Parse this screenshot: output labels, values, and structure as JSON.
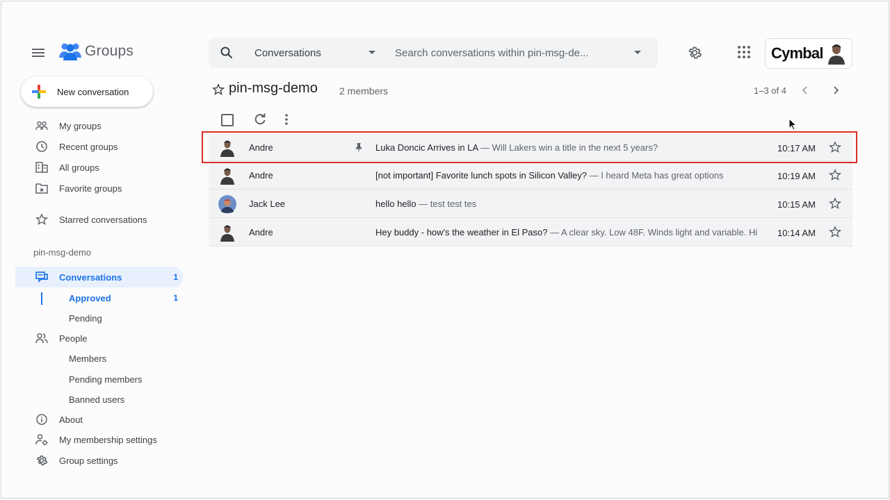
{
  "app": {
    "name": "Groups"
  },
  "search": {
    "scope": "Conversations",
    "placeholder": "Search conversations within pin-msg-de..."
  },
  "account": {
    "brand": "Cymbal"
  },
  "sidebar": {
    "new_conversation": "New conversation",
    "items": [
      {
        "label": "My groups",
        "icon": "my-groups-icon"
      },
      {
        "label": "Recent groups",
        "icon": "clock-icon"
      },
      {
        "label": "All groups",
        "icon": "building-icon"
      },
      {
        "label": "Favorite groups",
        "icon": "favorite-folder-icon"
      }
    ],
    "starred": "Starred conversations",
    "group_name": "pin-msg-demo",
    "conversations": {
      "label": "Conversations",
      "count": "1"
    },
    "approved": {
      "label": "Approved",
      "count": "1"
    },
    "pending": "Pending",
    "people": "People",
    "members": "Members",
    "pending_members": "Pending members",
    "banned_users": "Banned users",
    "about": "About",
    "membership_settings": "My membership settings",
    "group_settings": "Group settings"
  },
  "main": {
    "title": "pin-msg-demo",
    "members": "2 members",
    "pager": "1–3 of 4",
    "rows": [
      {
        "sender": "Andre",
        "subject": "Luka Doncic Arrives in LA",
        "snippet": " — Will Lakers win a title in the next 5 years?",
        "time": "10:17 AM",
        "pinned": true
      },
      {
        "sender": "Andre",
        "subject": "[not important] Favorite lunch spots in Silicon Valley?",
        "snippet": " — I heard Meta has great options",
        "time": "10:19 AM",
        "pinned": false
      },
      {
        "sender": "Jack Lee",
        "subject": "hello hello",
        "snippet": " — test test tes",
        "time": "10:15 AM",
        "pinned": false
      },
      {
        "sender": "Andre",
        "subject": "Hey buddy - how's the weather in El Paso?",
        "snippet": " — A clear sky. Low 48F. Winds light and variable. Hi",
        "time": "10:14 AM",
        "pinned": false
      }
    ]
  },
  "colors": {
    "accent": "#1a73e8",
    "active_bg": "#e8f0fe",
    "highlight_border": "#d93025",
    "row_bg": "#f2f3f5"
  }
}
